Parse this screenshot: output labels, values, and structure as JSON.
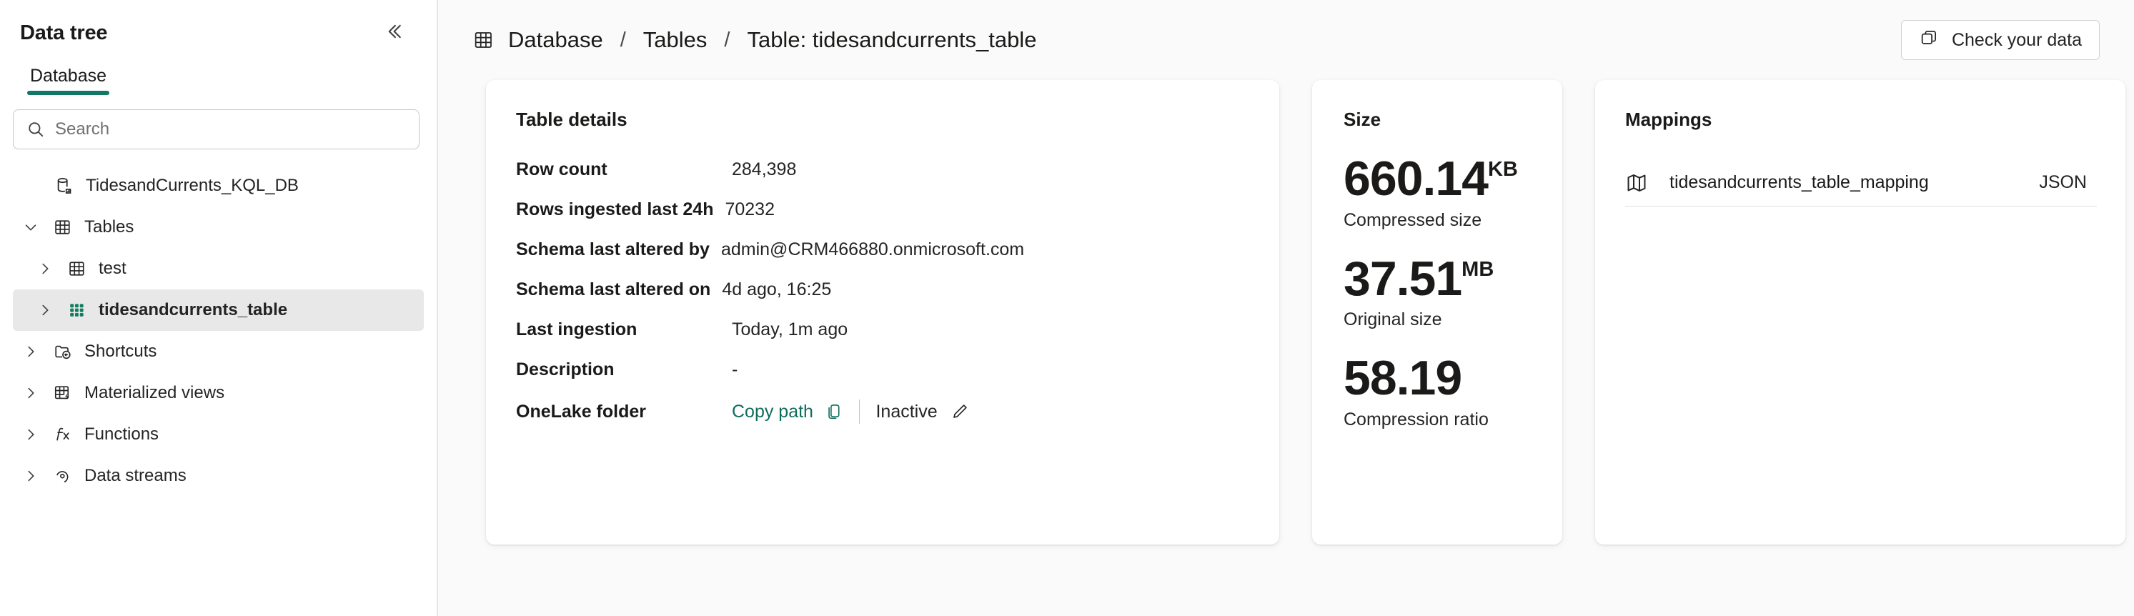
{
  "sidebar": {
    "title": "Data tree",
    "collapse_icon": "chevron-double-left-icon",
    "tabs": [
      {
        "label": "Database",
        "active": true
      }
    ],
    "search": {
      "placeholder": "Search",
      "value": "",
      "icon": "search-icon"
    },
    "tree": [
      {
        "label": "TidesandCurrents_KQL_DB",
        "icon": "database-icon",
        "indent": 0,
        "chevron": "none",
        "selected": false
      },
      {
        "label": "Tables",
        "icon": "table-icon",
        "indent": 1,
        "chevron": "down",
        "selected": false
      },
      {
        "label": "test",
        "icon": "table-icon",
        "indent": 2,
        "chevron": "right",
        "selected": false
      },
      {
        "label": "tidesandcurrents_table",
        "icon": "table-filled-icon",
        "indent": 2,
        "chevron": "right",
        "selected": true
      },
      {
        "label": "Shortcuts",
        "icon": "shortcut-folder-icon",
        "indent": 1,
        "chevron": "right",
        "selected": false
      },
      {
        "label": "Materialized views",
        "icon": "materialized-view-icon",
        "indent": 1,
        "chevron": "right",
        "selected": false
      },
      {
        "label": "Functions",
        "icon": "function-icon",
        "indent": 1,
        "chevron": "right",
        "selected": false
      },
      {
        "label": "Data streams",
        "icon": "data-stream-icon",
        "indent": 1,
        "chevron": "right",
        "selected": false
      }
    ]
  },
  "header": {
    "icon": "table-icon",
    "breadcrumb": [
      {
        "label": "Database",
        "link": true
      },
      {
        "label": "Tables",
        "link": true
      },
      {
        "label": "Table: tidesandcurrents_table",
        "link": false
      }
    ],
    "separator": "/",
    "check_button": {
      "label": "Check your data",
      "icon": "copy-pages-icon"
    }
  },
  "details_card": {
    "title": "Table details",
    "rows": [
      {
        "label": "Row count",
        "value": "284,398"
      },
      {
        "label": "Rows ingested last 24h",
        "value": "70232"
      },
      {
        "label": "Schema last altered by",
        "value": "admin@CRM466880.onmicrosoft.com"
      },
      {
        "label": "Schema last altered on",
        "value": "4d ago, 16:25"
      },
      {
        "label": "Last ingestion",
        "value": "Today, 1m ago"
      },
      {
        "label": "Description",
        "value": "-"
      }
    ],
    "onelake": {
      "label": "OneLake folder",
      "copy_path": "Copy path",
      "copy_icon": "copy-icon",
      "status": "Inactive",
      "edit_icon": "pencil-icon"
    }
  },
  "size_card": {
    "title": "Size",
    "metrics": [
      {
        "value": "660.14",
        "unit": "KB",
        "caption": "Compressed size"
      },
      {
        "value": "37.51",
        "unit": "MB",
        "caption": "Original size"
      },
      {
        "value": "58.19",
        "unit": "",
        "caption": "Compression ratio"
      }
    ]
  },
  "mappings_card": {
    "title": "Mappings",
    "rows": [
      {
        "name": "tidesandcurrents_table_mapping",
        "kind": "JSON",
        "icon": "map-icon"
      }
    ]
  },
  "colors": {
    "accent": "#107865",
    "link": "#0f6c5d",
    "text": "#1b1a19",
    "panel_bg": "#fafafa",
    "selected_row": "#e8e8e8",
    "table_icon_green": "#127e5f"
  }
}
